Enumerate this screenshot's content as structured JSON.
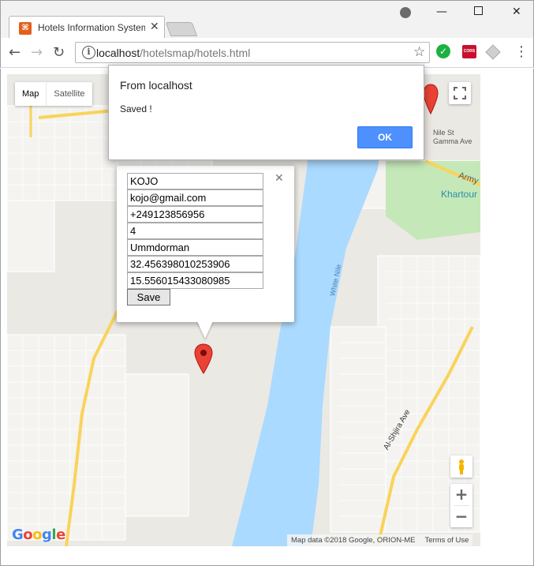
{
  "browser": {
    "tab_title": "Hotels Information System",
    "tab_favicon_icon": "xampp-icon",
    "url_host": "localhost",
    "url_path": "/hotelsmap/hotels.html",
    "extension_cors_label": "CORS"
  },
  "map": {
    "type_control": [
      "Map",
      "Satellite"
    ],
    "labels": {
      "nile_st": "Nile St",
      "gamma_ave": "Gamma Ave",
      "army": "Army",
      "khartoum": "Khartour",
      "white_nile": "White Nile",
      "al_shjira_ave": "Al-Shjira Ave"
    },
    "google_logo": "Google",
    "attribution": "Map data ©2018 Google, ORION-ME",
    "terms": "Terms of Use",
    "colors": {
      "water": "#aadaff",
      "land": "#ebe9e4",
      "road": "#f9d35b",
      "park": "#c5e8b8",
      "marker": "#ea4335"
    }
  },
  "infowindow": {
    "fields": [
      "KOJO",
      "kojo@gmail.com",
      "+249123856956",
      "4",
      "Ummdorman",
      "32.456398010253906",
      "15.556015433080985"
    ],
    "save_label": "Save"
  },
  "dialog": {
    "title": "From localhost",
    "message": "Saved !",
    "ok_label": "OK"
  }
}
